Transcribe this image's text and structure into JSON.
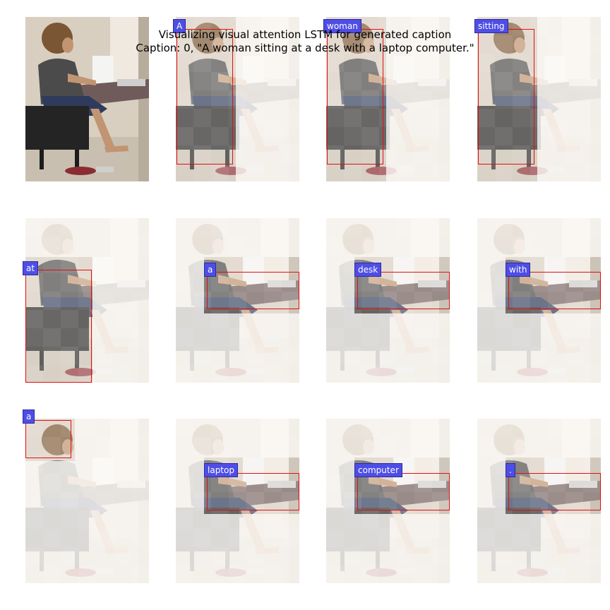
{
  "title": "Visualizing visual attention LSTM for generated caption",
  "caption_line": "Caption: 0, \"A woman sitting at a desk with a laptop computer.\"",
  "words": [
    "A",
    "woman",
    "sitting",
    "at",
    "a",
    "desk",
    "with",
    "a",
    "laptop",
    "computer",
    "."
  ],
  "colors": {
    "box": "#e01010",
    "label_bg": "#4e4ee6"
  }
}
